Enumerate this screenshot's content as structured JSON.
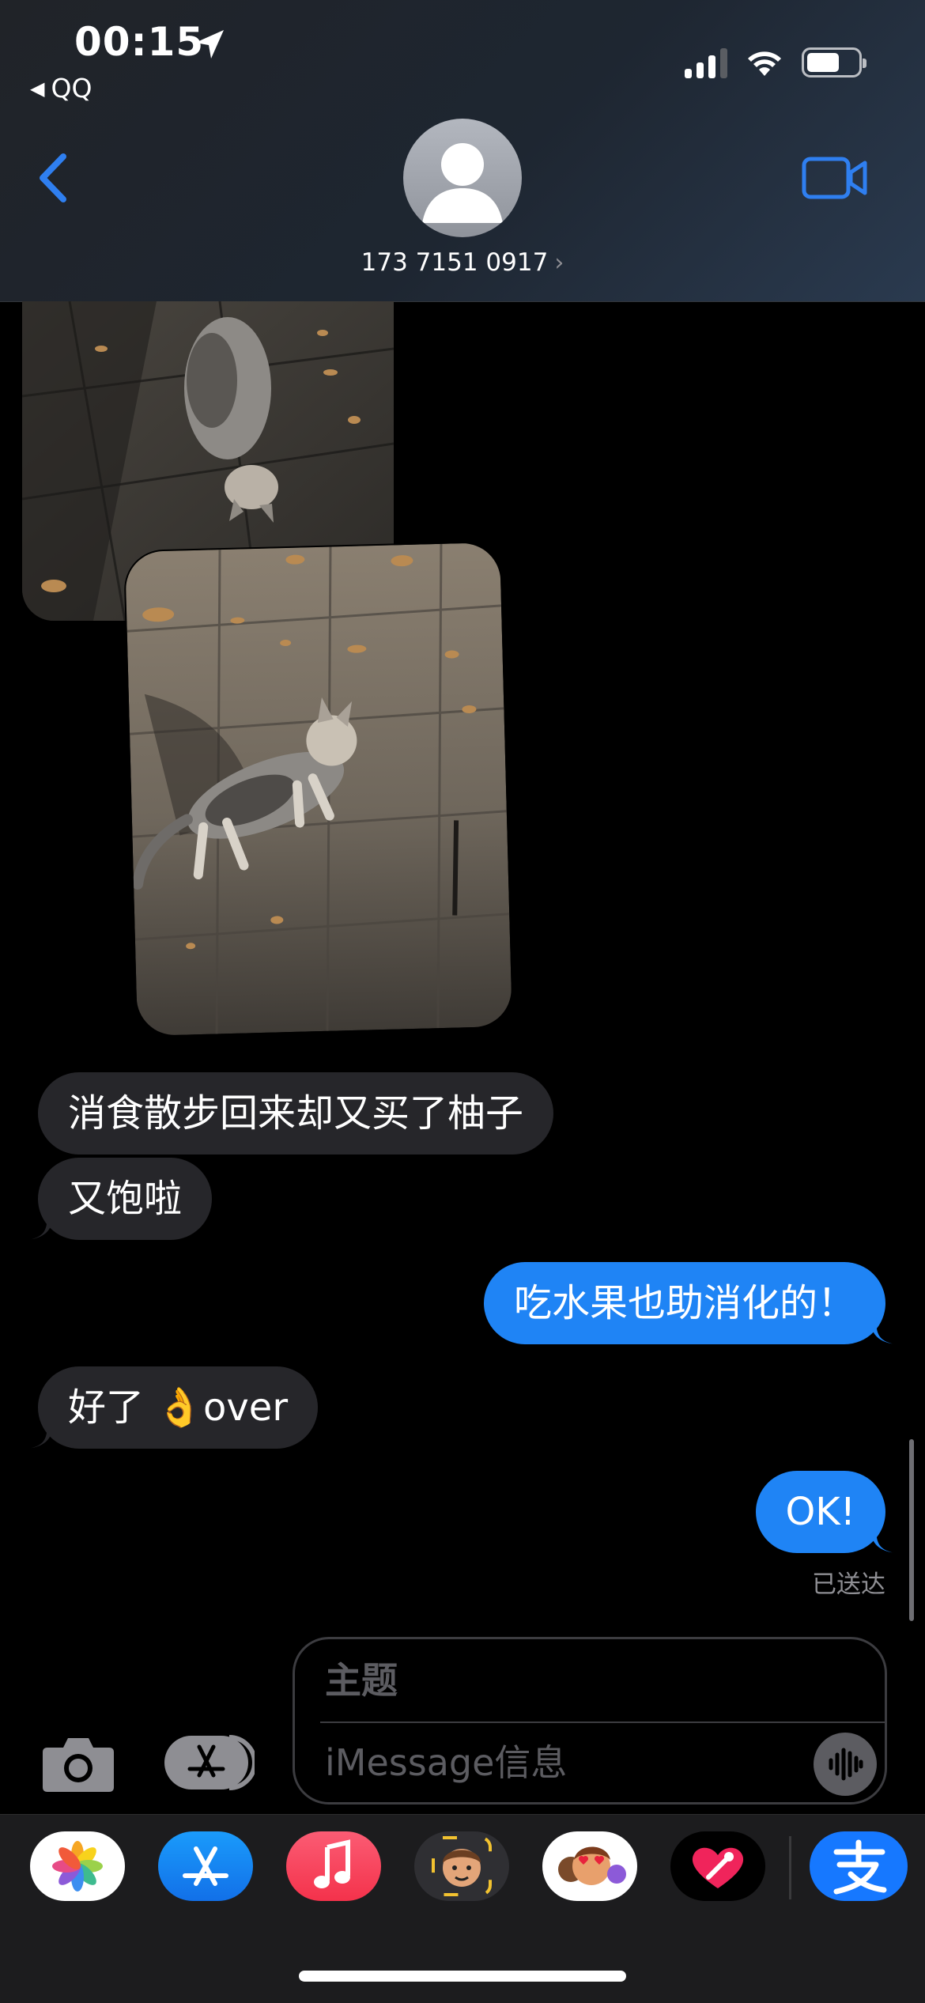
{
  "status_bar": {
    "time": "00:15",
    "back_app": "QQ"
  },
  "header": {
    "contact": "173 7151 0917"
  },
  "messages": [
    {
      "side": "received",
      "text": "消食散步回来却又买了柚子"
    },
    {
      "side": "received",
      "text": "又饱啦"
    },
    {
      "side": "sent",
      "text": "吃水果也助消化的！"
    },
    {
      "side": "received",
      "text": "好了 👌over"
    },
    {
      "side": "sent",
      "text": "OK!"
    }
  ],
  "delivered_label": "已送达",
  "compose": {
    "subject_placeholder": "主题",
    "message_placeholder": "iMessage信息"
  },
  "drawer_apps": [
    "photos-app",
    "app-store-app",
    "music-app",
    "memoji-app",
    "animoji-app",
    "digital-touch-app",
    "alipay-app"
  ],
  "colors": {
    "sent_bubble": "#1f84f5",
    "received_bubble": "#26262a",
    "accent": "#2f7ff0"
  }
}
